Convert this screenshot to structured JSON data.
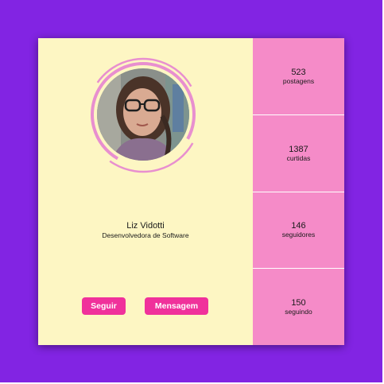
{
  "profile": {
    "name": "Liz Vidotti",
    "role": "Desenvolvedora de Software",
    "avatar_icon": "profile-photo"
  },
  "actions": {
    "follow_label": "Seguir",
    "message_label": "Mensagem"
  },
  "stats": [
    {
      "value": "523",
      "label": "postagens"
    },
    {
      "value": "1387",
      "label": "curtidas"
    },
    {
      "value": "146",
      "label": "seguidores"
    },
    {
      "value": "150",
      "label": "seguindo"
    }
  ],
  "colors": {
    "background": "#8224e3",
    "card": "#fdf6c3",
    "stats_panel": "#f58bc8",
    "accent": "#f0319b"
  }
}
